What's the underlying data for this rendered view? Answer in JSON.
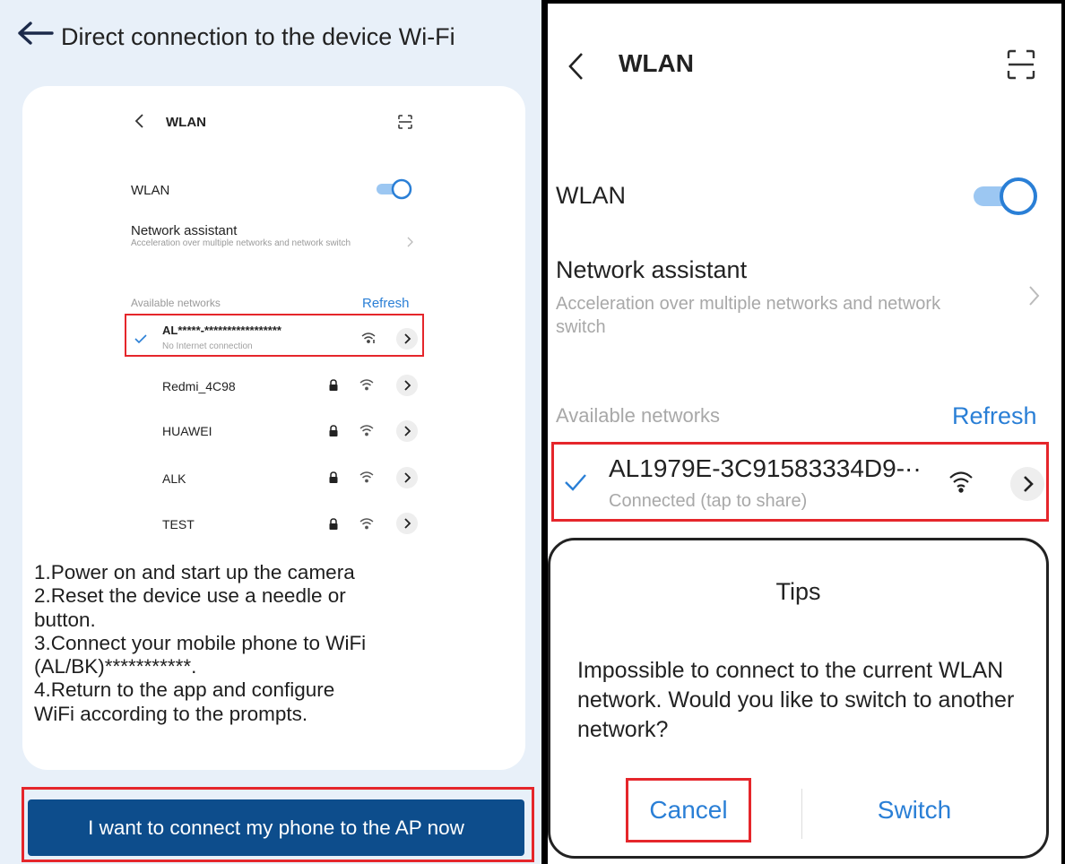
{
  "left_panel": {
    "header": {
      "title": "Direct connection to the device Wi-Fi"
    },
    "mini_wlan": {
      "title": "WLAN",
      "wlan_label": "WLAN",
      "wlan_enabled": true,
      "network_assistant": {
        "title": "Network assistant",
        "subtitle": "Acceleration over multiple networks and network switch"
      },
      "available_label": "Available networks",
      "refresh_label": "Refresh",
      "connected_network": {
        "name": "AL*****-*****************",
        "status": "No Internet connection"
      },
      "networks": [
        {
          "name": "Redmi_4C98"
        },
        {
          "name": "HUAWEI"
        },
        {
          "name": "ALK"
        },
        {
          "name": "TEST"
        }
      ]
    },
    "instructions": [
      "1.Power on and start up the camera",
      "2.Reset the device use a needle or",
      "button.",
      "3.Connect your mobile phone to WiFi",
      "(AL/BK)***********.",
      "4.Return to the app and configure",
      "WiFi according to the prompts."
    ],
    "connect_button_label": "I want to connect my phone to the AP now"
  },
  "right_panel": {
    "header": {
      "title": "WLAN"
    },
    "wlan_label": "WLAN",
    "wlan_enabled": true,
    "network_assistant": {
      "title": "Network assistant",
      "subtitle": "Acceleration over multiple networks and network switch"
    },
    "available_label": "Available networks",
    "refresh_label": "Refresh",
    "connected_network": {
      "name": "AL1979E-3C91583334D9-··",
      "status": "Connected (tap to share)"
    },
    "dialog": {
      "title": "Tips",
      "message": "Impossible to connect to the current WLAN network. Would you like to switch to another network?",
      "cancel_label": "Cancel",
      "switch_label": "Switch"
    }
  },
  "colors": {
    "accent": "#2a7fd6",
    "button_bg": "#0d4d8c",
    "highlight": "#e5262b",
    "left_bg": "#e8f0f9"
  }
}
